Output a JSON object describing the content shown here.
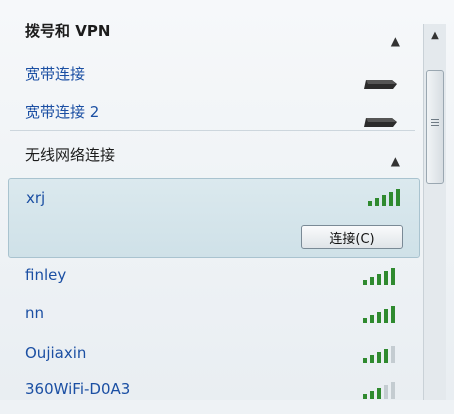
{
  "dialup_section": {
    "title": "拨号和 VPN"
  },
  "wired": [
    {
      "label": "宽带连接"
    },
    {
      "label": "宽带连接 2"
    }
  ],
  "wireless_section": {
    "title": "无线网络连接"
  },
  "selected_network": {
    "label": "xrj",
    "signal_bars": 5,
    "connect_label": "连接(C)"
  },
  "networks": [
    {
      "label": "finley",
      "signal_bars": 5
    },
    {
      "label": "nn",
      "signal_bars": 5
    },
    {
      "label": "Oujiaxin",
      "signal_bars": 4
    },
    {
      "label": "360WiFi-D0A3",
      "signal_bars": 3
    }
  ],
  "icons": {
    "collapse": "chevron-up-icon",
    "dialup": "modem-icon",
    "signal": "wifi-signal-icon"
  },
  "colors": {
    "link_text": "#1b4fa3",
    "selected_bg": "#d4e6ec",
    "signal_green": "#2f8a2f"
  }
}
